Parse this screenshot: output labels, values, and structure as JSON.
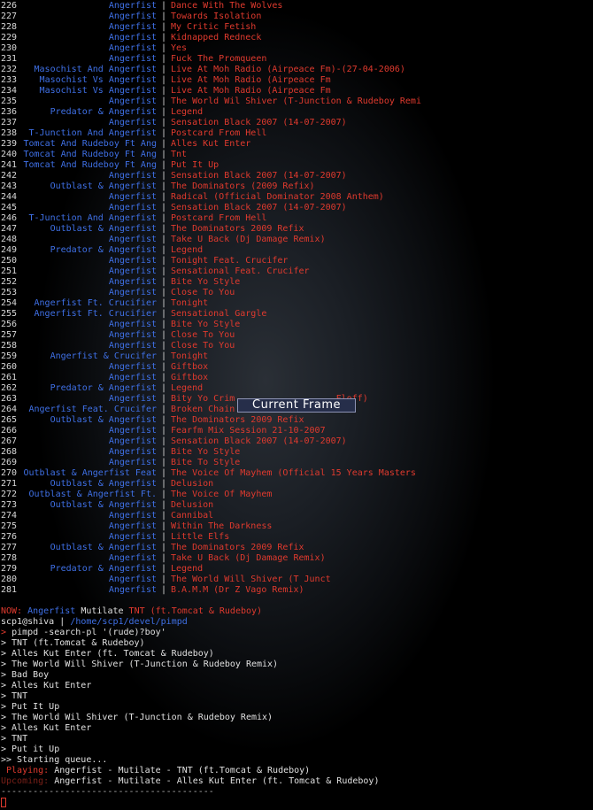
{
  "playlist": [
    {
      "num": "226",
      "artist": "Angerfist",
      "title": "Dance With The Wolves"
    },
    {
      "num": "227",
      "artist": "Angerfist",
      "title": "Towards Isolation"
    },
    {
      "num": "228",
      "artist": "Angerfist",
      "title": "My Critic Fetish"
    },
    {
      "num": "229",
      "artist": "Angerfist",
      "title": "Kidnapped Redneck"
    },
    {
      "num": "230",
      "artist": "Angerfist",
      "title": "Yes"
    },
    {
      "num": "231",
      "artist": "Angerfist",
      "title": "Fuck The Promqueen"
    },
    {
      "num": "232",
      "artist": "Masochist And Angerfist",
      "title": "Live At Moh Radio (Airpeace Fm)-(27-04-2006)"
    },
    {
      "num": "233",
      "artist": "Masochist Vs Angerfist",
      "title": "Live At Moh Radio (Airpeace Fm"
    },
    {
      "num": "234",
      "artist": "Masochist Vs Angerfist",
      "title": "Live At Moh Radio (Airpeace Fm"
    },
    {
      "num": "235",
      "artist": "Angerfist",
      "title": "The World Wil Shiver (T-Junction & Rudeboy Remi"
    },
    {
      "num": "236",
      "artist": "Predator & Angerfist",
      "title": "Legend"
    },
    {
      "num": "237",
      "artist": "Angerfist",
      "title": "Sensation Black 2007 (14-07-2007)"
    },
    {
      "num": "238",
      "artist": "T-Junction And Angerfist",
      "title": "Postcard From Hell"
    },
    {
      "num": "239",
      "artist": "Tomcat And Rudeboy Ft Ang",
      "title": "Alles Kut Enter"
    },
    {
      "num": "240",
      "artist": "Tomcat And Rudeboy Ft Ang",
      "title": "Tnt"
    },
    {
      "num": "241",
      "artist": "Tomcat And Rudeboy Ft Ang",
      "title": "Put It Up"
    },
    {
      "num": "242",
      "artist": "Angerfist",
      "title": "Sensation Black 2007 (14-07-2007)"
    },
    {
      "num": "243",
      "artist": "Outblast & Angerfist",
      "title": "The Dominators (2009 Refix)"
    },
    {
      "num": "244",
      "artist": "Angerfist",
      "title": "Radical (Official Dominator 2008 Anthem)"
    },
    {
      "num": "245",
      "artist": "Angerfist",
      "title": "Sensation Black 2007 (14-07-2007)"
    },
    {
      "num": "246",
      "artist": "T-Junction And Angerfist",
      "title": "Postcard From Hell"
    },
    {
      "num": "247",
      "artist": "Outblast & Angerfist",
      "title": "The Dominators 2009 Refix"
    },
    {
      "num": "248",
      "artist": "Angerfist",
      "title": "Take U Back (Dj Damage Remix)"
    },
    {
      "num": "249",
      "artist": "Predator & Angerfist",
      "title": "Legend"
    },
    {
      "num": "250",
      "artist": "Angerfist",
      "title": "Tonight Feat. Crucifer"
    },
    {
      "num": "251",
      "artist": "Angerfist",
      "title": "Sensational Feat. Crucifer"
    },
    {
      "num": "252",
      "artist": "Angerfist",
      "title": "Bite Yo Style"
    },
    {
      "num": "253",
      "artist": "Angerfist",
      "title": "Close To You"
    },
    {
      "num": "254",
      "artist": "Angerfist Ft. Crucifier",
      "title": "Tonight"
    },
    {
      "num": "255",
      "artist": "Angerfist Ft. Crucifier",
      "title": "Sensational Gargle"
    },
    {
      "num": "256",
      "artist": "Angerfist",
      "title": "Bite Yo Style"
    },
    {
      "num": "257",
      "artist": "Angerfist",
      "title": "Close To You"
    },
    {
      "num": "258",
      "artist": "Angerfist",
      "title": "Close To You"
    },
    {
      "num": "259",
      "artist": "Angerfist & Crucifer",
      "title": "Tonight"
    },
    {
      "num": "260",
      "artist": "Angerfist",
      "title": "Giftbox"
    },
    {
      "num": "261",
      "artist": "Angerfist",
      "title": "Giftbox"
    },
    {
      "num": "262",
      "artist": "Predator & Angerfist",
      "title": "Legend"
    },
    {
      "num": "263",
      "artist": "Angerfist",
      "title": "Bity Yo Crim                   Floff)"
    },
    {
      "num": "264",
      "artist": "Angerfist Feat. Crucifer",
      "title": "Broken Chain"
    },
    {
      "num": "265",
      "artist": "Outblast & Angerfist",
      "title": "The Dominators 2009 Refix"
    },
    {
      "num": "266",
      "artist": "Angerfist",
      "title": "Fearfm Mix Session 21-10-2007"
    },
    {
      "num": "267",
      "artist": "Angerfist",
      "title": "Sensation Black 2007 (14-07-2007)"
    },
    {
      "num": "268",
      "artist": "Angerfist",
      "title": "Bite Yo Style"
    },
    {
      "num": "269",
      "artist": "Angerfist",
      "title": "Bite To Style"
    },
    {
      "num": "270",
      "artist": "Outblast & Angerfist Feat",
      "title": "The Voice Of Mayhem (Official 15 Years Masters"
    },
    {
      "num": "271",
      "artist": "Outblast & Angerfist",
      "title": "Delusion"
    },
    {
      "num": "272",
      "artist": "Outblast & Angerfist Ft.",
      "title": "The Voice Of Mayhem"
    },
    {
      "num": "273",
      "artist": "Outblast & Angerfist",
      "title": "Delusion"
    },
    {
      "num": "274",
      "artist": "Angerfist",
      "title": "Cannibal"
    },
    {
      "num": "275",
      "artist": "Angerfist",
      "title": "Within The Darkness"
    },
    {
      "num": "276",
      "artist": "Angerfist",
      "title": "Little Elfs"
    },
    {
      "num": "277",
      "artist": "Outblast & Angerfist",
      "title": "The Dominators 2009 Refix"
    },
    {
      "num": "278",
      "artist": "Angerfist",
      "title": "Take U Back (Dj Damage Remix)"
    },
    {
      "num": "279",
      "artist": "Predator & Angerfist",
      "title": "Legend"
    },
    {
      "num": "280",
      "artist": "Angerfist",
      "title": "The World Will Shiver (T Junct"
    },
    {
      "num": "281",
      "artist": "Angerfist",
      "title": "B.A.M.M (Dr Z Vago Remix)"
    }
  ],
  "separator": "|",
  "now_playing": {
    "label": "NOW:",
    "artist": "Angerfist",
    "album": "Mutilate",
    "title": "TNT (ft.Tomcat & Rudeboy)"
  },
  "prompt": {
    "user_host": "scp1@shiva",
    "separator": "|",
    "path": "/home/scp1/devel/pimpd",
    "arrow": ">",
    "command": "pimpd -search-pl '(rude)?boy'"
  },
  "search_results": [
    "> TNT (ft.Tomcat & Rudeboy)",
    "> Alles Kut Enter (ft. Tomcat & Rudeboy)",
    "> The World Will Shiver (T-Junction & Rudeboy Remix)",
    "> Bad Boy",
    "> Alles Kut Enter",
    "> TNT",
    "> Put It Up",
    "> The World Wil Shiver (T-Junction & Rudeboy Remix)",
    "> Alles Kut Enter",
    "> TNT",
    "> Put it Up"
  ],
  "queue": {
    "starting": ">> Starting queue...",
    "playing_label": " Playing:",
    "playing_text": "Angerfist - Mutilate - TNT (ft.Tomcat & Rudeboy)",
    "upcoming_label": "Upcoming:",
    "upcoming_text": "Angerfist - Mutilate - Alles Kut Enter (ft. Tomcat & Rudeboy)"
  },
  "rule": "----------------------------------------",
  "tooltip": {
    "label": "Current Frame"
  },
  "colors": {
    "accent_red": "#e03a2e",
    "accent_blue": "#3f70e6",
    "text": "#e0e0e0",
    "background": "#000000"
  }
}
